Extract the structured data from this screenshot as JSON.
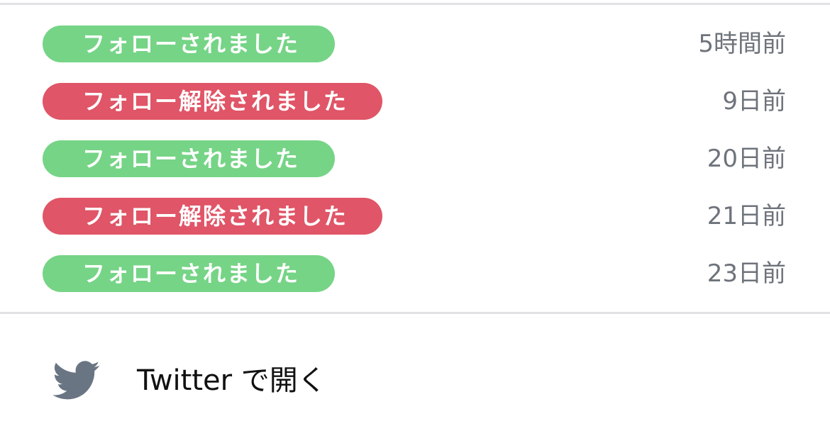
{
  "history": [
    {
      "status": "follow",
      "label": "フォローされました",
      "time": "5時間前"
    },
    {
      "status": "unfollow",
      "label": "フォロー解除されました",
      "time": "9日前"
    },
    {
      "status": "follow",
      "label": "フォローされました",
      "time": "20日前"
    },
    {
      "status": "unfollow",
      "label": "フォロー解除されました",
      "time": "21日前"
    },
    {
      "status": "follow",
      "label": "フォローされました",
      "time": "23日前"
    }
  ],
  "colors": {
    "follow": "#76d486",
    "unfollow": "#e05567",
    "timestamp": "#6e737b",
    "icon": "#6a7584"
  },
  "open_link": {
    "icon": "twitter-bird-icon",
    "label": "Twitter で開く"
  }
}
